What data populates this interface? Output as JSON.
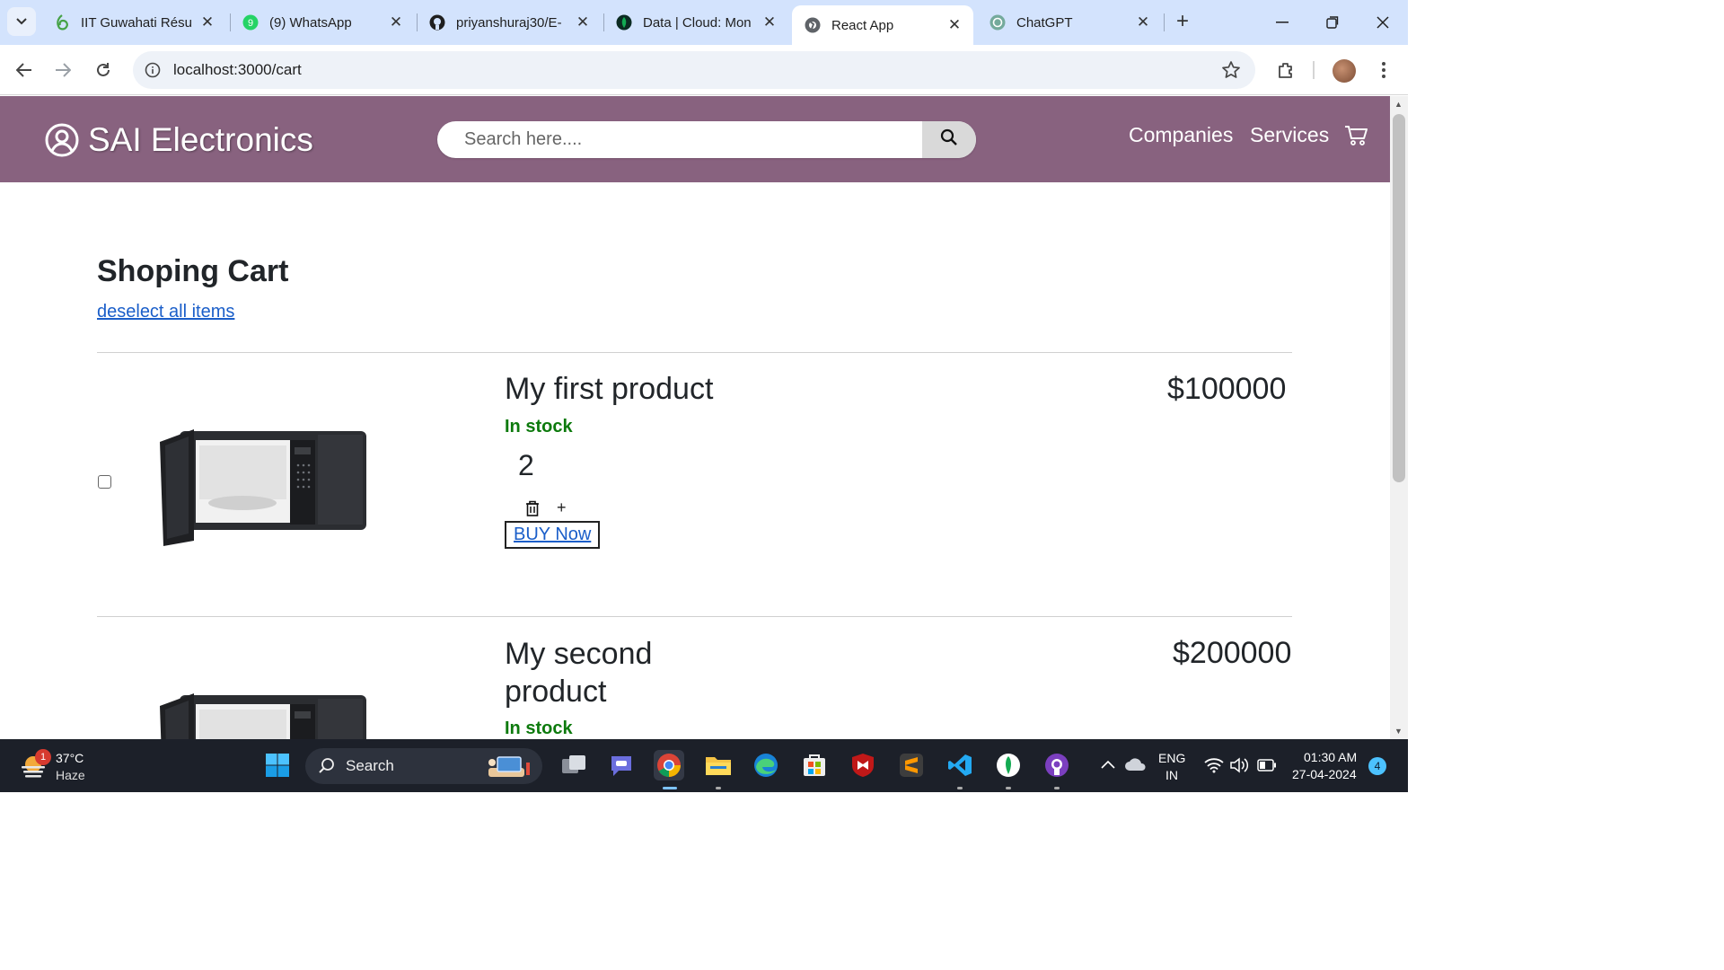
{
  "browser": {
    "tabs": [
      {
        "title": "IIT Guwahati Résu",
        "icon": "overleaf-icon"
      },
      {
        "title": "(9) WhatsApp",
        "icon": "whatsapp-icon"
      },
      {
        "title": "priyanshuraj30/E-",
        "icon": "github-icon"
      },
      {
        "title": "Data | Cloud: Mon",
        "icon": "mongodb-icon"
      },
      {
        "title": "React App",
        "icon": "globe-icon",
        "active": true
      },
      {
        "title": "ChatGPT",
        "icon": "chatgpt-icon"
      }
    ],
    "url": "localhost:3000/cart"
  },
  "site": {
    "brand": "SAI Electronics",
    "search_placeholder": "Search here....",
    "nav": [
      "Companies",
      "Services"
    ],
    "accent_color": "#88627f"
  },
  "cart": {
    "heading": "Shoping Cart",
    "deselect_label": "deselect all items",
    "items": [
      {
        "title": "My first product",
        "stock": "In stock",
        "quantity": "2",
        "buy_label": "BUY Now",
        "plus_label": "+",
        "price": "$100000",
        "checked": false
      },
      {
        "title": "My second product",
        "stock": "In stock",
        "price": "$200000",
        "checked": false
      }
    ]
  },
  "taskbar": {
    "weather_temp": "37°C",
    "weather_desc": "Haze",
    "weather_badge": "1",
    "search_label": "Search",
    "lang1": "ENG",
    "lang2": "IN",
    "time": "01:30 AM",
    "date": "27-04-2024",
    "notif_count": "4"
  }
}
